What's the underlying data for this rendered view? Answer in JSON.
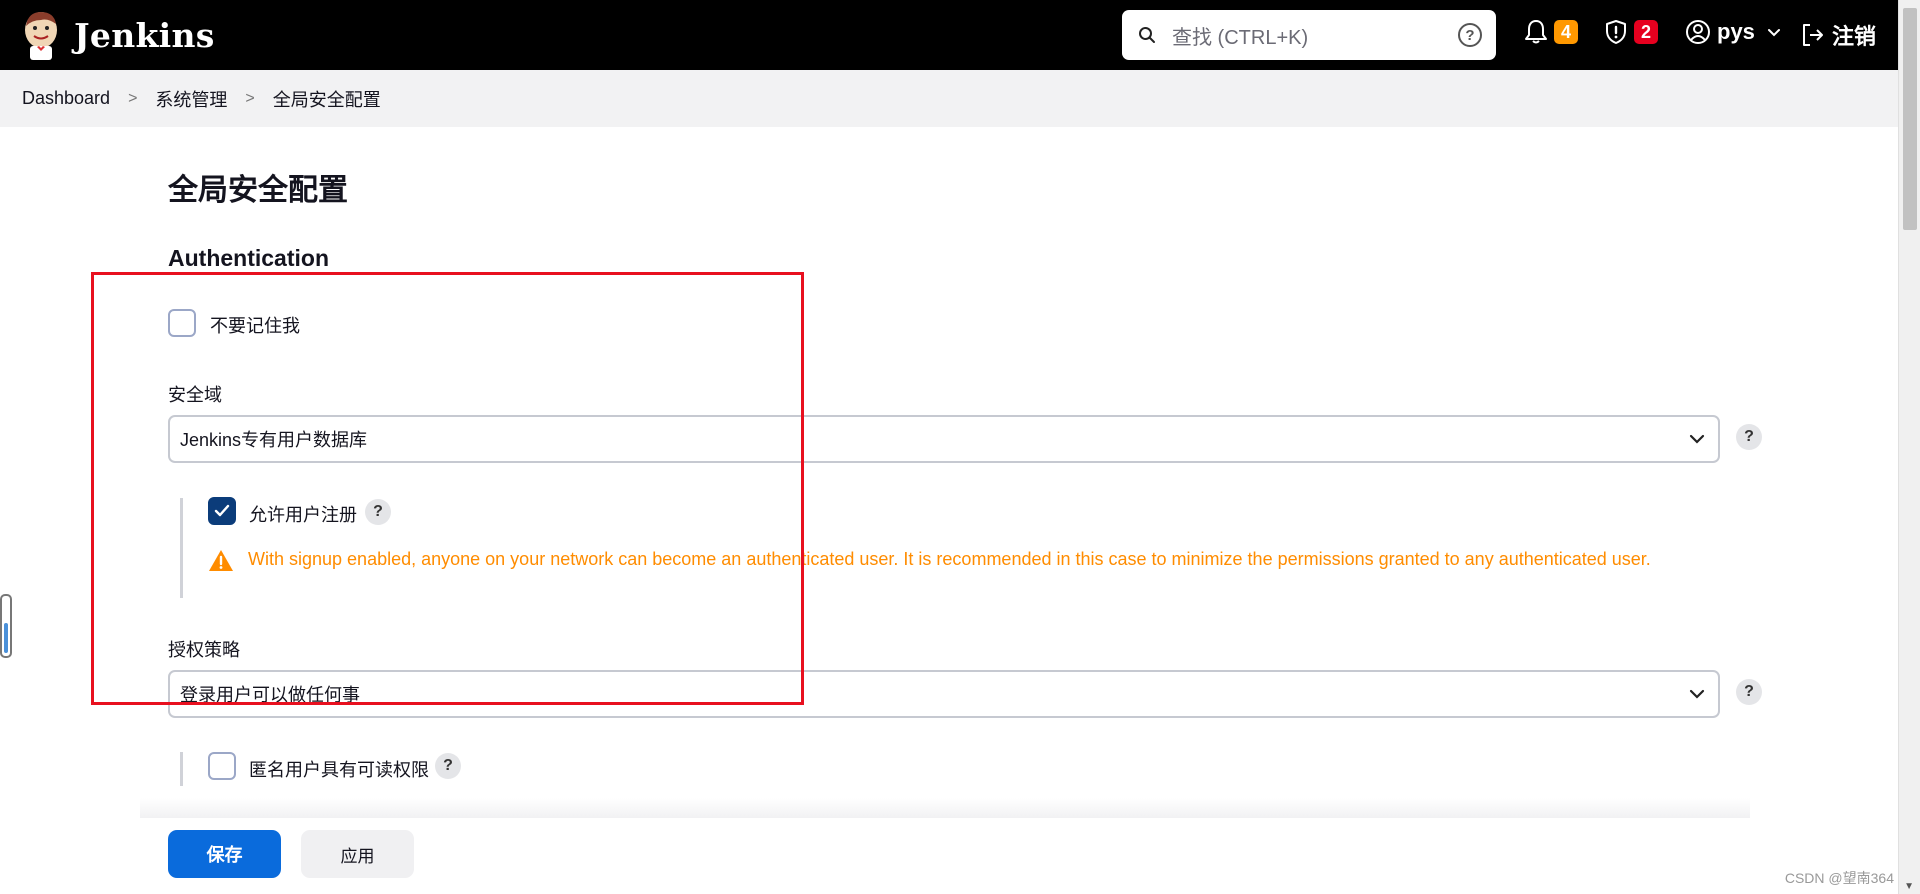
{
  "header": {
    "app_name": "Jenkins",
    "search_placeholder": "查找 (CTRL+K)",
    "notifications_count": "4",
    "security_count": "2",
    "user_name": "pys",
    "logout_label": "注销"
  },
  "breadcrumb": {
    "items": [
      "Dashboard",
      "系统管理",
      "全局安全配置"
    ]
  },
  "page": {
    "title": "全局安全配置",
    "section_title": "Authentication",
    "remember_me_label": "不要记住我",
    "remember_me_checked": false,
    "security_realm_label": "安全域",
    "security_realm_value": "Jenkins专有用户数据库",
    "allow_signup_label": "允许用户注册",
    "allow_signup_checked": true,
    "signup_warning": "With signup enabled, anyone on your network can become an authenticated user. It is recommended in this case to minimize the permissions granted to any authenticated user.",
    "authorization_label": "授权策略",
    "authorization_value": "登录用户可以做任何事",
    "anonymous_read_label": "匿名用户具有可读权限",
    "anonymous_read_checked": false
  },
  "actions": {
    "save_label": "保存",
    "apply_label": "应用"
  },
  "watermark": "CSDN @望南364",
  "colors": {
    "header_bg": "#000000",
    "primary": "#0a6bdc",
    "warning": "#ff8c00",
    "highlight_box": "#e8101f",
    "badge_orange": "#ff9800",
    "badge_red": "#e6001f"
  },
  "icons": [
    "jenkins-logo",
    "search-icon",
    "help-circle-icon",
    "bell-icon",
    "shield-icon",
    "user-icon",
    "chevron-down-icon",
    "logout-icon",
    "warning-icon",
    "check-icon"
  ]
}
